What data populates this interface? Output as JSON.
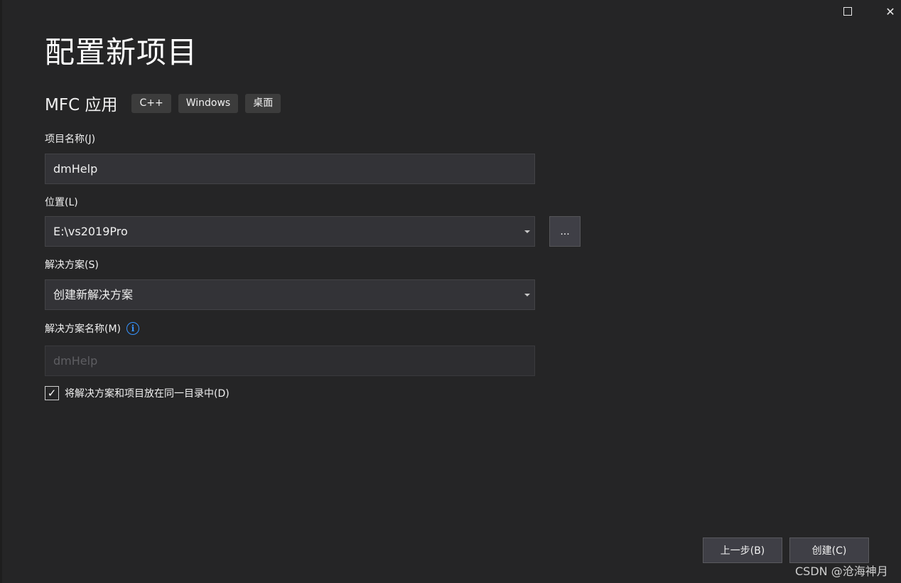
{
  "window": {
    "maximize_icon": "maximize-icon",
    "close_glyph": "✕"
  },
  "header": {
    "title": "配置新项目",
    "template_name": "MFC 应用",
    "tags": [
      "C++",
      "Windows",
      "桌面"
    ]
  },
  "form": {
    "project_name": {
      "label": "项目名称(J)",
      "value": "dmHelp"
    },
    "location": {
      "label": "位置(L)",
      "value": "E:\\vs2019Pro",
      "browse_label": "..."
    },
    "solution": {
      "label": "解决方案(S)",
      "value": "创建新解决方案"
    },
    "solution_name": {
      "label": "解决方案名称(M)",
      "info_glyph": "i",
      "placeholder": "dmHelp"
    },
    "same_directory": {
      "checked": true,
      "check_glyph": "✓",
      "label": "将解决方案和项目放在同一目录中(D)"
    }
  },
  "footer": {
    "back_label": "上一步(B)",
    "create_label": "创建(C)"
  },
  "watermark": "CSDN @沧海神月",
  "colors": {
    "background": "#252526",
    "input_bg": "#333337",
    "button_bg": "#3f3f46",
    "info_accent": "#3794ff"
  }
}
